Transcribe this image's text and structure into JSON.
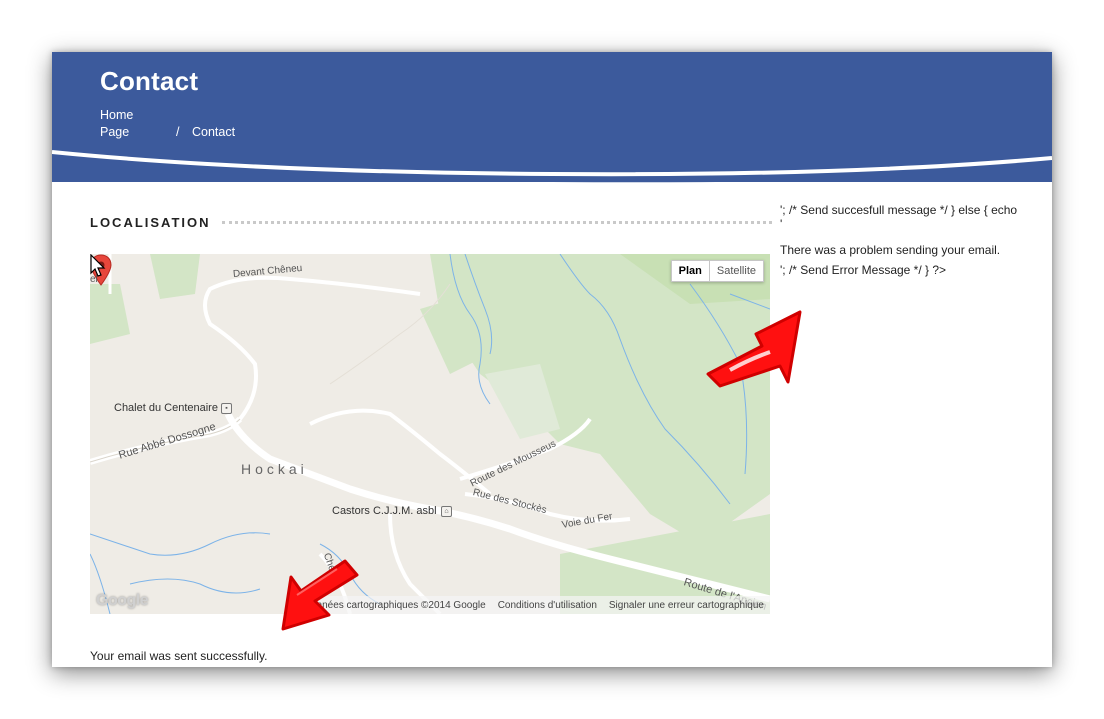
{
  "header": {
    "title": "Contact",
    "breadcrumb": {
      "home": "Home",
      "page": "Page",
      "separator": "/",
      "current": "Contact"
    }
  },
  "section": {
    "title": "LOCALISATION"
  },
  "map": {
    "type_buttons": [
      "Plan",
      "Satellite"
    ],
    "selected_type": "Plan",
    "labels": {
      "chalet": "Chalet du Centenaire",
      "town": "Hockai",
      "castors": "Castors C.J.J.M. asbl",
      "devant_cheneu": "Devant Chêneu",
      "rue_abbe": "Rue Abbé Dossogne",
      "route_mousseus": "Route des Mousseus",
      "rue_stockes": "Rue des Stockès",
      "voie_fer": "Voie du Fer",
      "route_ancien": "Route de l'Ancien",
      "chemin": "Chemin",
      "edge": "el"
    },
    "footer": {
      "data": "Données cartographiques ©2014 Google",
      "terms": "Conditions d'utilisation",
      "report": "Signaler une erreur cartographique"
    },
    "logo": "Google",
    "colors": {
      "land": "#efece6",
      "green": "#d3e5c6",
      "water": "#7cb3e8",
      "road": "#ffffff"
    }
  },
  "messages": {
    "success": "Your email was sent successfully.",
    "code_line1": "'; /* Send succesfull message  */ } else { echo",
    "code_line2": "'",
    "error": "There was a problem sending your email.",
    "code_line3": "'; /* Send Error Message */ } ?>"
  },
  "colors": {
    "header_bg": "#3c5a9c",
    "annotation": "#ff1010"
  }
}
